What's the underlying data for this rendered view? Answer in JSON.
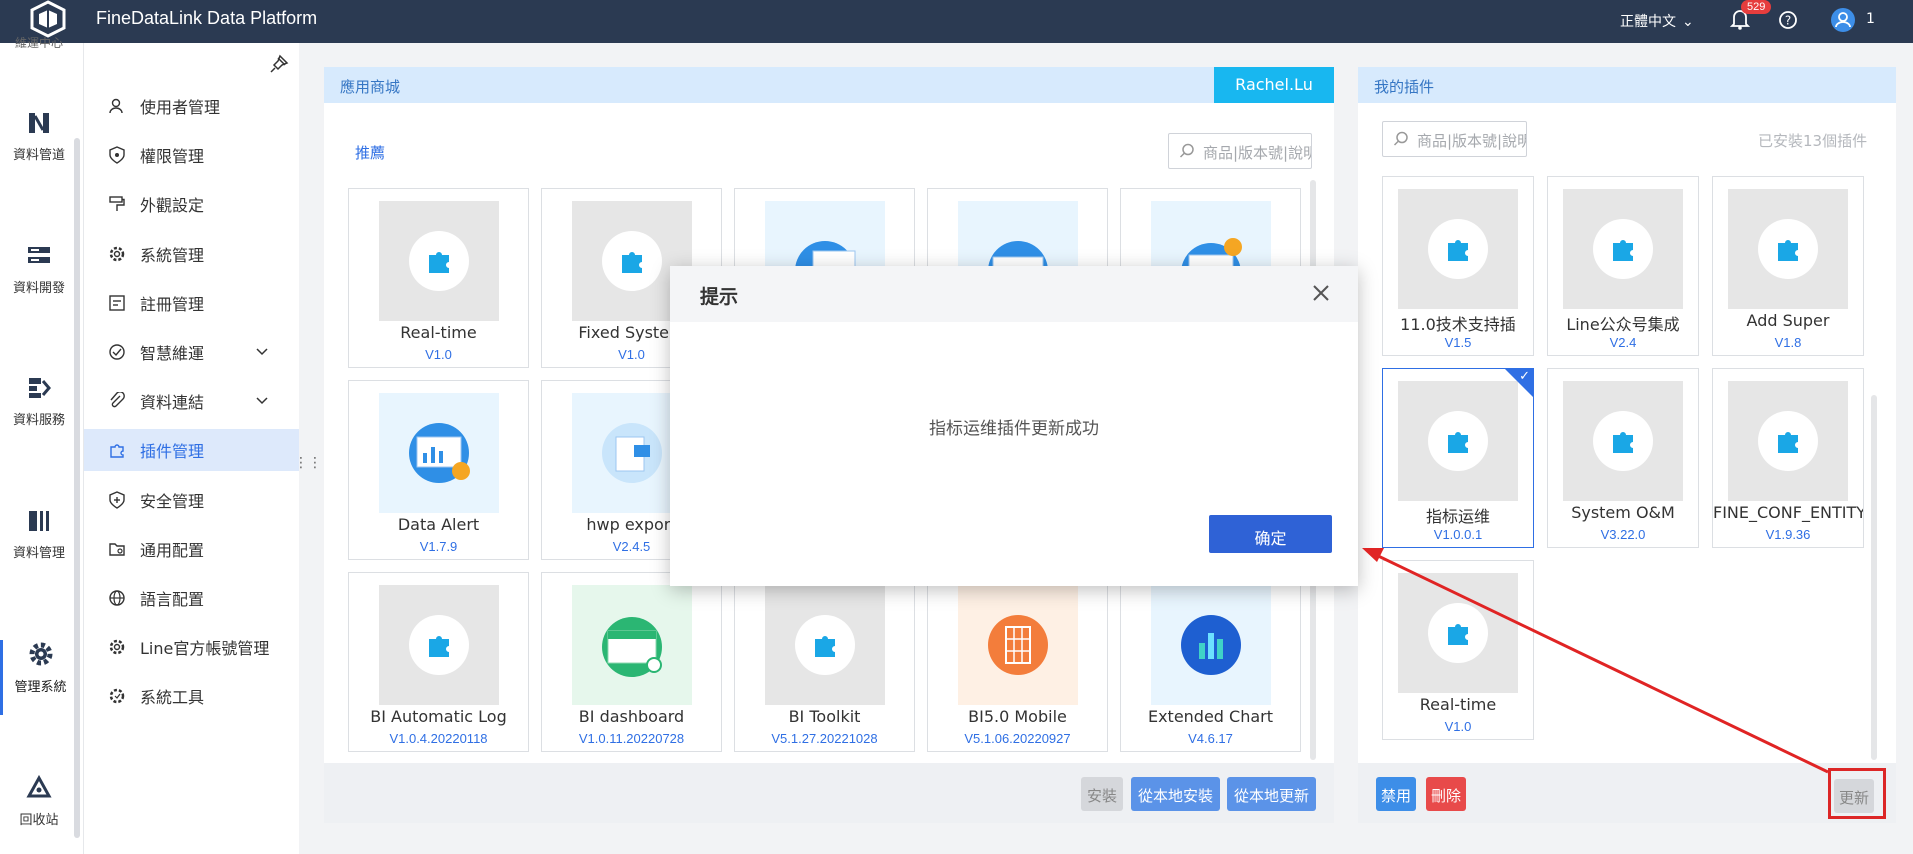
{
  "app": {
    "title": "FineDataLink Data Platform"
  },
  "topbar": {
    "language": "正體中文",
    "notifications": "529",
    "user_number": "1"
  },
  "rail": {
    "partial_top": "維運中心",
    "items": [
      "資料管道",
      "資料開發",
      "資料服務",
      "資料管理",
      "管理系統",
      "回收站"
    ]
  },
  "sidebar": {
    "items": [
      "使用者管理",
      "權限管理",
      "外觀設定",
      "系統管理",
      "註冊管理",
      "智慧維運",
      "資料連結",
      "插件管理",
      "安全管理",
      "通用配置",
      "語言配置",
      "Line官方帳號管理",
      "系統工具"
    ]
  },
  "store": {
    "header": "應用商城",
    "user": "Rachel.Lu",
    "section": "推薦",
    "search_placeholder": "商品|版本號|說明",
    "cards": [
      {
        "name": "Real-time",
        "version": "V1.0"
      },
      {
        "name": "Fixed System",
        "version": "V1.0"
      },
      {
        "name": "",
        "version": ""
      },
      {
        "name": "",
        "version": ""
      },
      {
        "name": "",
        "version": ""
      },
      {
        "name": "Data Alert",
        "version": "V1.7.9"
      },
      {
        "name": "hwp export",
        "version": "V2.4.5"
      },
      {
        "name": "BI Automatic Log",
        "version": "V1.0.4.20220118"
      },
      {
        "name": "BI dashboard",
        "version": "V1.0.11.20220728"
      },
      {
        "name": "BI Toolkit",
        "version": "V5.1.27.20221028"
      },
      {
        "name": "BI5.0 Mobile",
        "version": "V5.1.06.20220927"
      },
      {
        "name": "Extended Chart",
        "version": "V4.6.17"
      }
    ],
    "buttons": {
      "install": "安裝",
      "local_install": "從本地安裝",
      "local_update": "從本地更新"
    }
  },
  "my_plugins": {
    "header": "我的插件",
    "search_placeholder": "商品|版本號|說明",
    "installed": "已安裝13個插件",
    "cards": [
      {
        "name": "11.0技术支持插",
        "version": "V1.5"
      },
      {
        "name": "Line公众号集成",
        "version": "V2.4"
      },
      {
        "name": "Add Super",
        "version": "V1.8"
      },
      {
        "name": "指标运维",
        "version": "V1.0.0.1"
      },
      {
        "name": "System O&M",
        "version": "V3.22.0"
      },
      {
        "name": "FINE_CONF_ENTITY",
        "version": "V1.9.36"
      },
      {
        "name": "Real-time",
        "version": "V1.0"
      }
    ],
    "buttons": {
      "disable": "禁用",
      "delete": "刪除",
      "update": "更新"
    }
  },
  "dialog": {
    "title": "提示",
    "message": "指标运维插件更新成功",
    "ok": "确定"
  },
  "colors": {
    "topbar": "#2b3a52",
    "accent": "#2f6fe4",
    "panel_header": "#d7eafd",
    "user_chip": "#18b7f0",
    "highlight": "#dc2626"
  }
}
